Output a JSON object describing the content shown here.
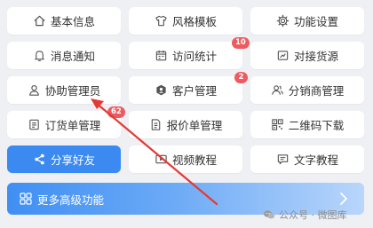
{
  "tiles": [
    {
      "label": "基本信息",
      "icon": "home-icon"
    },
    {
      "label": "风格模板",
      "icon": "shirt-icon"
    },
    {
      "label": "功能设置",
      "icon": "gear-icon"
    },
    {
      "label": "消息通知",
      "icon": "bell-icon"
    },
    {
      "label": "访问统计",
      "icon": "calendar-icon"
    },
    {
      "label": "对接货源",
      "icon": "link-icon"
    },
    {
      "label": "协助管理员",
      "icon": "user-icon"
    },
    {
      "label": "客户管理",
      "icon": "customer-icon"
    },
    {
      "label": "分销商管理",
      "icon": "distributor-icon"
    },
    {
      "label": "订货单管理",
      "icon": "order-icon"
    },
    {
      "label": "报价单管理",
      "icon": "quote-icon"
    },
    {
      "label": "二维码下载",
      "icon": "qrcode-icon"
    },
    {
      "label": "分享好友",
      "icon": "share-icon"
    },
    {
      "label": "视频教程",
      "icon": "video-icon"
    },
    {
      "label": "文字教程",
      "icon": "chat-icon"
    }
  ],
  "badges": {
    "visit_stats": "10",
    "customer": "2",
    "order": "62"
  },
  "more_bar": {
    "label": "更多高级功能",
    "icon": "grid-icon"
  },
  "watermark": {
    "text": "公众号 · 微图库",
    "icon": "wechat-icon"
  },
  "colors": {
    "primary": "#3a8af2",
    "badge": "#ee5a5f",
    "annotation_arrow": "#e53935"
  }
}
